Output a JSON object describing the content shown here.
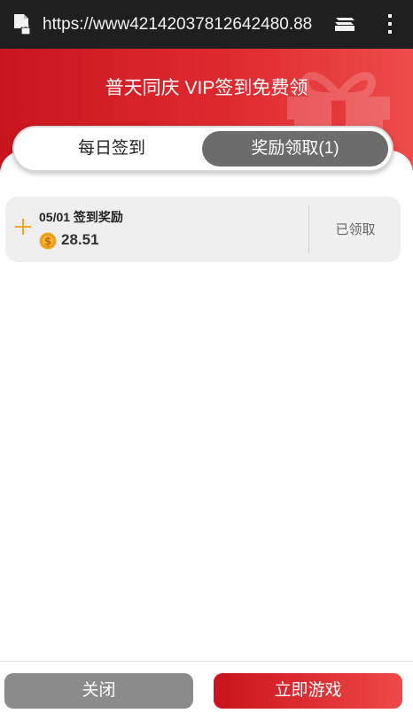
{
  "browser": {
    "url": "https://www42142037812642480.88",
    "icons": [
      "page-icon",
      "tabs-icon",
      "menu-icon"
    ]
  },
  "header": {
    "title": "普天同庆 VIP签到免费领",
    "accent_color": "#d8232a"
  },
  "tabs": [
    {
      "label": "每日签到",
      "active": false
    },
    {
      "label": "奖励领取(1)",
      "active": true
    }
  ],
  "records": [
    {
      "title": "05/01 签到奖励",
      "amount": "28.51",
      "status": "已领取",
      "icons": [
        "plus-icon",
        "coin-icon"
      ]
    }
  ],
  "footer": {
    "close_label": "关闭",
    "play_label": "立即游戏"
  }
}
